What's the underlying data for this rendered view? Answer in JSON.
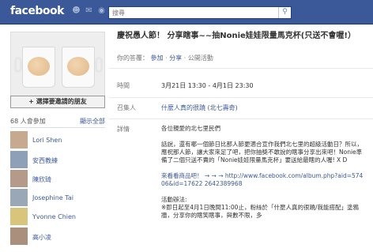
{
  "header": {
    "logo": "facebook",
    "search_value": "搜尋",
    "icons": [
      "friends-icon",
      "messages-icon",
      "notifications-icon"
    ]
  },
  "sidebar": {
    "invite_button": "+ 選擇要邀請的朋友",
    "attending_count": "68 人會參加",
    "show_all": "顯示全部",
    "attendees": [
      {
        "name": "Lori Shen",
        "avatar_color": "#c7a98f"
      },
      {
        "name": "安西教練",
        "avatar_color": "#8ea0b8"
      },
      {
        "name": "陳欣琦",
        "avatar_color": "#b59a8a"
      },
      {
        "name": "Josephine Tai",
        "avatar_color": "#9aa7b6"
      },
      {
        "name": "Yvonne Chien",
        "avatar_color": "#d8c47a"
      },
      {
        "name": "高小凌",
        "avatar_color": "#a98f7c"
      }
    ]
  },
  "event": {
    "title": "慶祝愚人節！ 分享瞎事~~抽Nonie娃娃限量馬克杯(只送不會喔!）",
    "host_prefix": "你的答覆：",
    "host_links": [
      "參加",
      "分享",
      "公開活動"
    ],
    "time_label": "時間",
    "time_value": "3月21日 13:30 - 4月1日 23:30",
    "organizer_label": "召集人",
    "organizer_value": "什麼人真的很蹺 (北七壽奇)",
    "details_label": "詳情",
    "details_paragraphs": [
      "各位親愛的北七里民們",
      "話說，還有哪一個節日比那人節更適合宣作我們北七里的超級活動日？所以，應祝那人節，讓大家來足了吧，把你抽獎不敢說的瞎事分享出來吧！Nonie準備了二個只送不賣的「Nonie娃娃限量馬克杯」要送給最瞎的人喔! X D",
      "來看看商品吧！ → → → http://www.facebook.com/album.php?aid=57406&id=17622 2642389968",
      "活動辦法:",
      "※即日起至4月1日晚間11:00止，粉絲於「什麼人真的很蹺/我能搭配」塗鴉牆，分享你的瞎笑瞎事，與數不限，多"
    ]
  },
  "colors": {
    "brand_blue": "#3b5998",
    "link": "#3b5998"
  }
}
